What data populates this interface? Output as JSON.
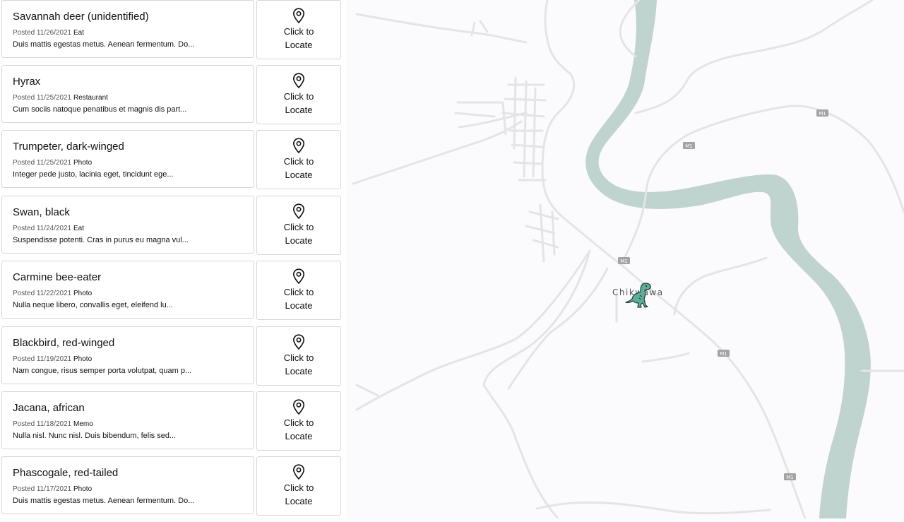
{
  "posts": [
    {
      "title": "Savannah deer (unidentified)",
      "posted": "Posted 11/26/2021",
      "tag": "Eat",
      "description": "Duis mattis egestas metus. Aenean fermentum. Do...",
      "locate_label": "Click to Locate"
    },
    {
      "title": "Hyrax",
      "posted": "Posted 11/25/2021",
      "tag": "Restaurant",
      "description": "Cum sociis natoque penatibus et magnis dis part...",
      "locate_label": "Click to Locate"
    },
    {
      "title": "Trumpeter, dark-winged",
      "posted": "Posted 11/25/2021",
      "tag": "Photo",
      "description": "Integer pede justo, lacinia eget, tincidunt ege...",
      "locate_label": "Click to Locate"
    },
    {
      "title": "Swan, black",
      "posted": "Posted 11/24/2021",
      "tag": "Eat",
      "description": "Suspendisse potenti. Cras in purus eu magna vul...",
      "locate_label": "Click to Locate"
    },
    {
      "title": "Carmine bee-eater",
      "posted": "Posted 11/22/2021",
      "tag": "Photo",
      "description": "Nulla neque libero, convallis eget, eleifend lu...",
      "locate_label": "Click to Locate"
    },
    {
      "title": "Blackbird, red-winged",
      "posted": "Posted 11/19/2021",
      "tag": "Photo",
      "description": "Nam congue, risus semper porta volutpat, quam p...",
      "locate_label": "Click to Locate"
    },
    {
      "title": "Jacana, african",
      "posted": "Posted 11/18/2021",
      "tag": "Memo",
      "description": "Nulla nisl. Nunc nisl. Duis bibendum, felis sed...",
      "locate_label": "Click to Locate"
    },
    {
      "title": "Phascogale, red-tailed",
      "posted": "Posted 11/17/2021",
      "tag": "Photo",
      "description": "Duis mattis egestas metus. Aenean fermentum. Do...",
      "locate_label": "Click to Locate"
    }
  ],
  "map": {
    "town_label": "Chikwawa",
    "road_shield": "M1",
    "marker_icon": "dinosaur-icon",
    "colors": {
      "river": "#bfd3cf",
      "road": "#e4e3e7",
      "background": "#fbfafc",
      "shield": "#a3a3a3",
      "marker": "#5fae9a"
    }
  }
}
